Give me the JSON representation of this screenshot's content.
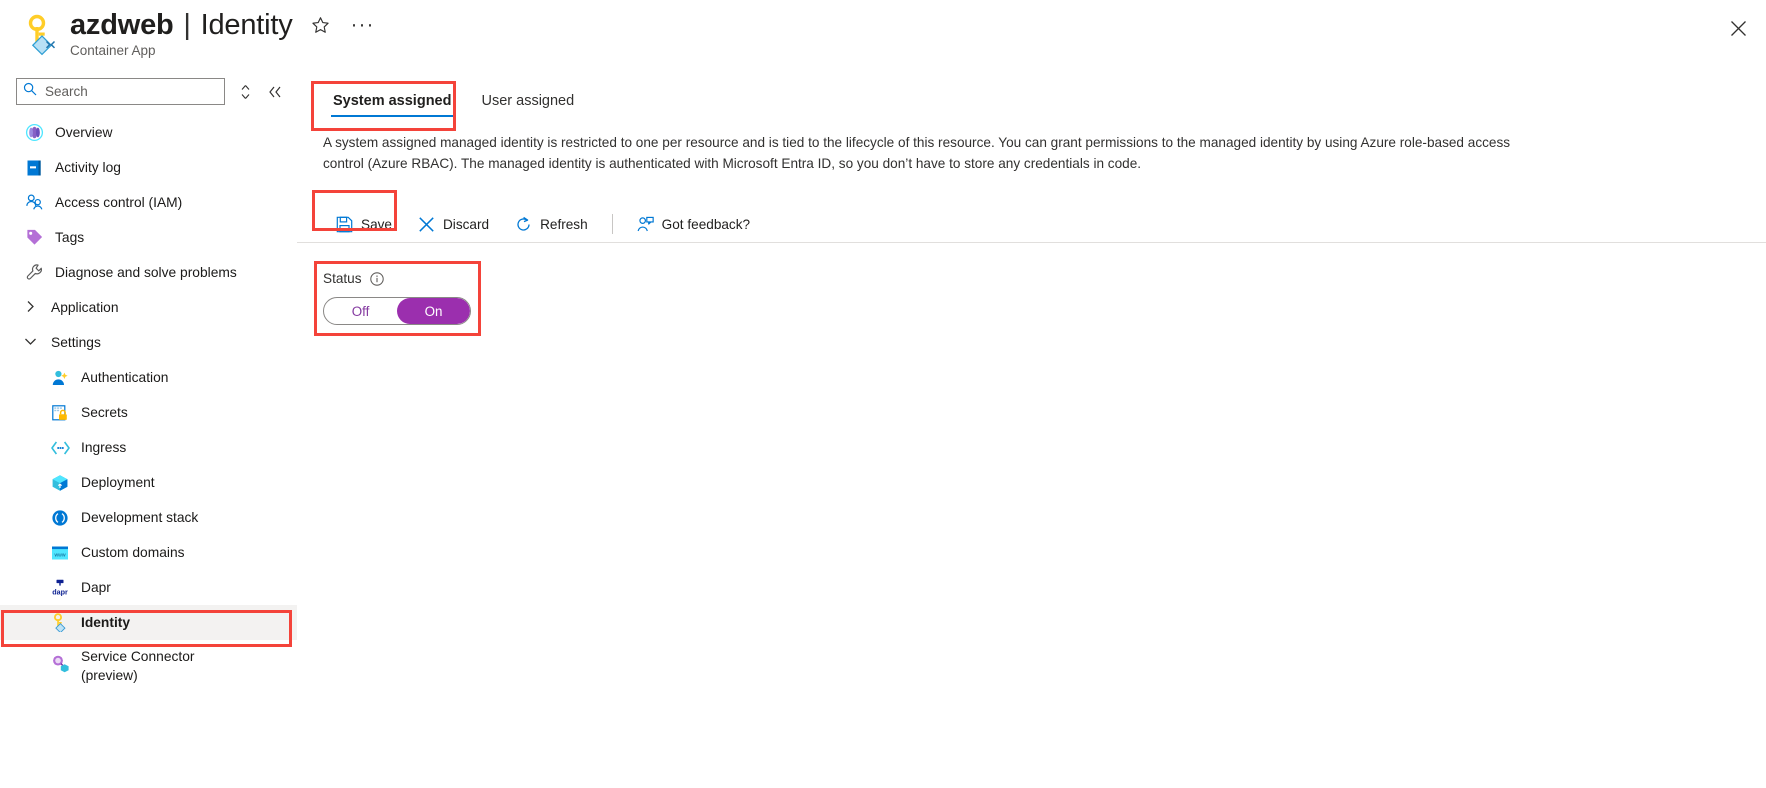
{
  "header": {
    "resource_name": "azdweb",
    "separator": "|",
    "page_name": "Identity",
    "subtitle": "Container App",
    "favorite_icon": "star-icon",
    "more_icon": "ellipsis-icon",
    "close_icon": "close-icon"
  },
  "sidebar": {
    "search": {
      "placeholder": "Search",
      "value": ""
    },
    "sort_icon": "sort-icon",
    "collapse_icon": "collapse-chevrons-icon",
    "items": [
      {
        "label": "Overview",
        "icon": "overview-icon",
        "level": "top",
        "selected": false
      },
      {
        "label": "Activity log",
        "icon": "activity-log-icon",
        "level": "top",
        "selected": false
      },
      {
        "label": "Access control (IAM)",
        "icon": "access-control-icon",
        "level": "top",
        "selected": false
      },
      {
        "label": "Tags",
        "icon": "tags-icon",
        "level": "top",
        "selected": false
      },
      {
        "label": "Diagnose and solve problems",
        "icon": "wrench-icon",
        "level": "top",
        "selected": false
      },
      {
        "label": "Application",
        "icon": "chevron-right-icon",
        "level": "group",
        "expanded": false,
        "selected": false
      },
      {
        "label": "Settings",
        "icon": "chevron-down-icon",
        "level": "group",
        "expanded": true,
        "selected": false
      },
      {
        "label": "Authentication",
        "icon": "authentication-icon",
        "level": "child",
        "selected": false
      },
      {
        "label": "Secrets",
        "icon": "secrets-lock-icon",
        "level": "child",
        "selected": false
      },
      {
        "label": "Ingress",
        "icon": "ingress-icon",
        "level": "child",
        "selected": false
      },
      {
        "label": "Deployment",
        "icon": "deployment-cube-icon",
        "level": "child",
        "selected": false
      },
      {
        "label": "Development stack",
        "icon": "development-stack-icon",
        "level": "child",
        "selected": false
      },
      {
        "label": "Custom domains",
        "icon": "custom-domains-icon",
        "level": "child",
        "selected": false
      },
      {
        "label": "Dapr",
        "icon": "dapr-icon",
        "level": "child",
        "selected": false
      },
      {
        "label": "Identity",
        "icon": "identity-key-icon",
        "level": "child",
        "selected": true
      },
      {
        "label": "Service Connector (preview)",
        "icon": "service-connector-icon",
        "level": "child",
        "selected": false
      }
    ]
  },
  "main": {
    "tabs": [
      {
        "label": "System assigned",
        "active": true
      },
      {
        "label": "User assigned",
        "active": false
      }
    ],
    "description": "A system assigned managed identity is restricted to one per resource and is tied to the lifecycle of this resource. You can grant permissions to the managed identity by using Azure role-based access control (Azure RBAC). The managed identity is authenticated with Microsoft Entra ID, so you don’t have to store any credentials in code.",
    "toolbar": [
      {
        "label": "Save",
        "icon": "save-floppy-icon"
      },
      {
        "label": "Discard",
        "icon": "discard-x-icon"
      },
      {
        "label": "Refresh",
        "icon": "refresh-icon"
      },
      {
        "label": "Got feedback?",
        "icon": "feedback-person-icon"
      }
    ],
    "status": {
      "label": "Status",
      "info_icon": "info-icon",
      "off_label": "Off",
      "on_label": "On",
      "value": "On"
    }
  },
  "colors": {
    "accent_blue": "#0078d4",
    "toggle_purple": "#9b2fae",
    "annotation_red": "#f4433a",
    "selected_row": "#f3f2f1"
  },
  "annotations": [
    {
      "name": "system-assigned-tab-highlight"
    },
    {
      "name": "save-button-highlight"
    },
    {
      "name": "status-toggle-highlight"
    },
    {
      "name": "identity-nav-highlight"
    }
  ]
}
